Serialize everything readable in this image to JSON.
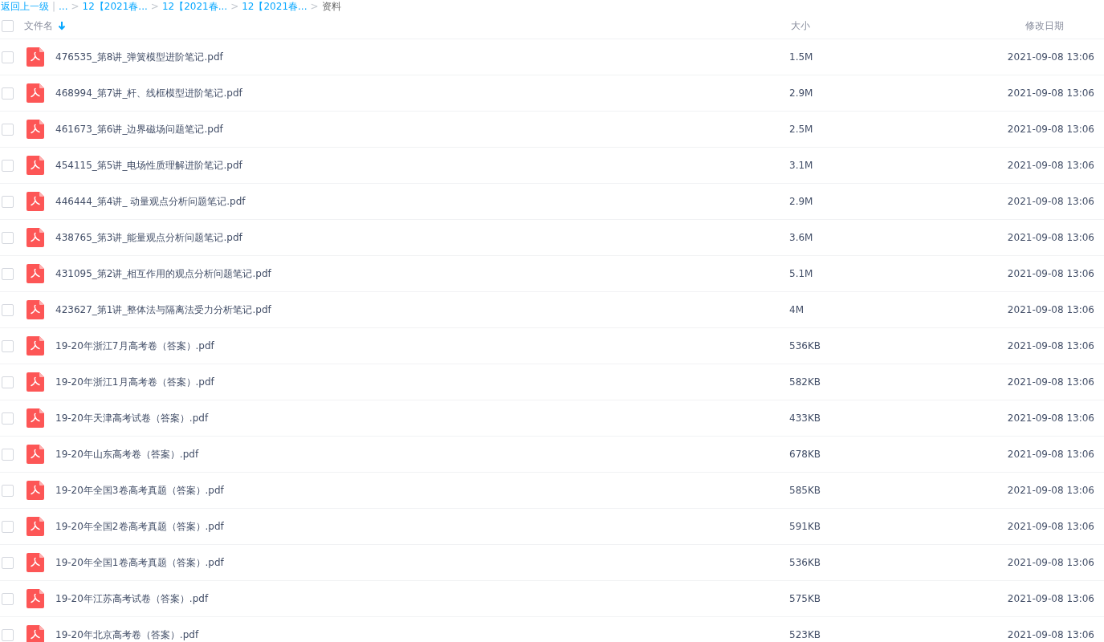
{
  "breadcrumb": [
    {
      "text": "返回上一级",
      "kind": "link"
    },
    {
      "text": "|",
      "kind": "divider"
    },
    {
      "text": "...",
      "kind": "link"
    },
    {
      "text": ">",
      "kind": "sep"
    },
    {
      "text": "12【2021春...",
      "kind": "link"
    },
    {
      "text": ">",
      "kind": "sep"
    },
    {
      "text": "12【2021春...",
      "kind": "link"
    },
    {
      "text": ">",
      "kind": "sep"
    },
    {
      "text": "12【2021春...",
      "kind": "link"
    },
    {
      "text": ">",
      "kind": "sep"
    },
    {
      "text": "资料",
      "kind": "current"
    }
  ],
  "table": {
    "select_all": {
      "checked": false
    },
    "columns": [
      {
        "label": "文件名",
        "sorted": true
      },
      {
        "label": "大小",
        "sorted": false
      },
      {
        "label": "修改日期",
        "sorted": false
      }
    ],
    "rows": [
      {
        "name": "476535_第8讲_弹簧模型进阶笔记.pdf",
        "size": "1.5M",
        "date": "2021-09-08 13:06",
        "checked": false
      },
      {
        "name": "468994_第7讲_杆、线框模型进阶笔记.pdf",
        "size": "2.9M",
        "date": "2021-09-08 13:06",
        "checked": false
      },
      {
        "name": "461673_第6讲_边界磁场问题笔记.pdf",
        "size": "2.5M",
        "date": "2021-09-08 13:06",
        "checked": false
      },
      {
        "name": "454115_第5讲_电场性质理解进阶笔记.pdf",
        "size": "3.1M",
        "date": "2021-09-08 13:06",
        "checked": false
      },
      {
        "name": "446444_第4讲_ 动量观点分析问题笔记.pdf",
        "size": "2.9M",
        "date": "2021-09-08 13:06",
        "checked": false
      },
      {
        "name": "438765_第3讲_能量观点分析问题笔记.pdf",
        "size": "3.6M",
        "date": "2021-09-08 13:06",
        "checked": false
      },
      {
        "name": "431095_第2讲_相互作用的观点分析问题笔记.pdf",
        "size": "5.1M",
        "date": "2021-09-08 13:06",
        "checked": false
      },
      {
        "name": "423627_第1讲_整体法与隔离法受力分析笔记.pdf",
        "size": "4M",
        "date": "2021-09-08 13:06",
        "checked": false
      },
      {
        "name": "19-20年浙江7月高考卷（答案）.pdf",
        "size": "536KB",
        "date": "2021-09-08 13:06",
        "checked": false
      },
      {
        "name": "19-20年浙江1月高考卷（答案）.pdf",
        "size": "582KB",
        "date": "2021-09-08 13:06",
        "checked": false
      },
      {
        "name": "19-20年天津高考试卷（答案）.pdf",
        "size": "433KB",
        "date": "2021-09-08 13:06",
        "checked": false
      },
      {
        "name": "19-20年山东高考卷（答案）.pdf",
        "size": "678KB",
        "date": "2021-09-08 13:06",
        "checked": false
      },
      {
        "name": "19-20年全国3卷高考真题（答案）.pdf",
        "size": "585KB",
        "date": "2021-09-08 13:06",
        "checked": false
      },
      {
        "name": "19-20年全国2卷高考真题（答案）.pdf",
        "size": "591KB",
        "date": "2021-09-08 13:06",
        "checked": false
      },
      {
        "name": "19-20年全国1卷高考真题（答案）.pdf",
        "size": "536KB",
        "date": "2021-09-08 13:06",
        "checked": false
      },
      {
        "name": "19-20年江苏高考试卷（答案）.pdf",
        "size": "575KB",
        "date": "2021-09-08 13:06",
        "checked": false
      },
      {
        "name": "19-20年北京高考卷（答案）.pdf",
        "size": "523KB",
        "date": "2021-09-08 13:06",
        "checked": false
      }
    ]
  }
}
